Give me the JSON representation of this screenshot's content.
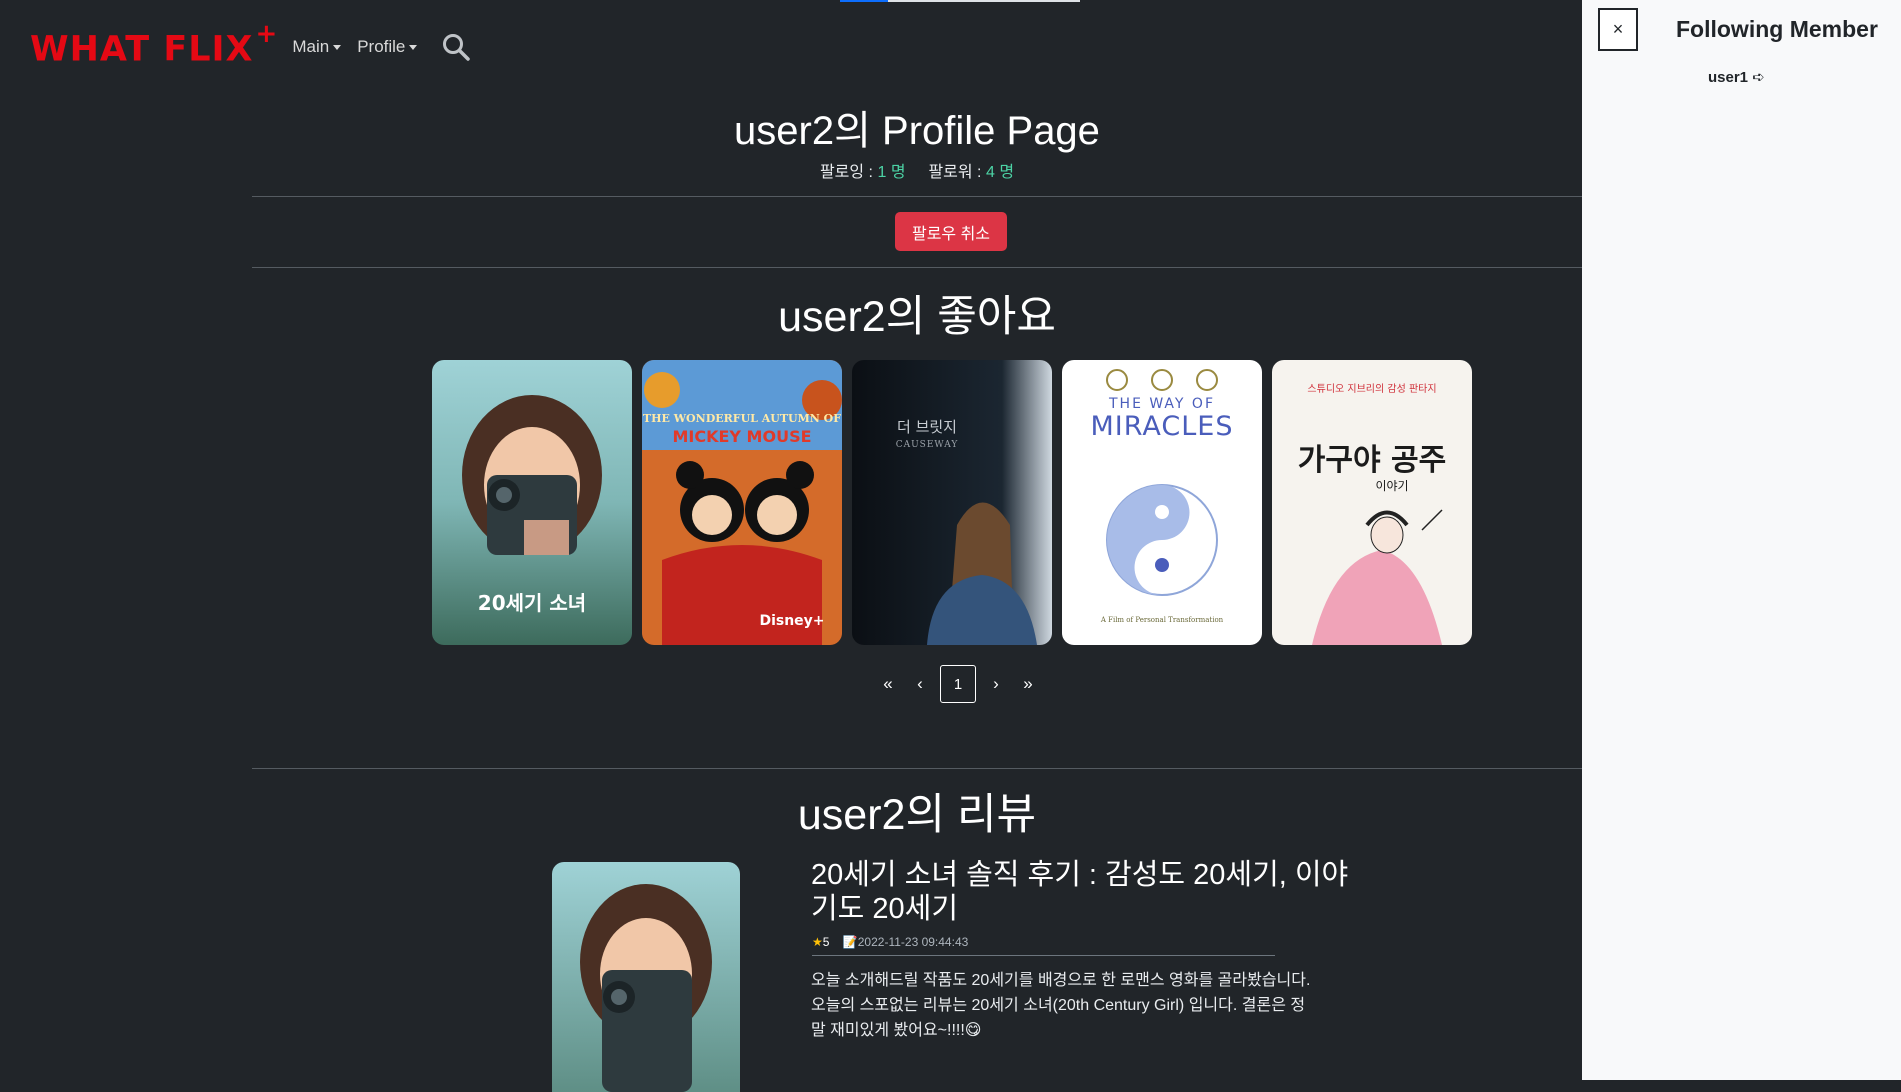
{
  "navbar": {
    "brand": "WHAT FLIX",
    "brand_plus": "+",
    "items": [
      {
        "label": "Main"
      },
      {
        "label": "Profile"
      }
    ]
  },
  "profile": {
    "title": "user2의 Profile Page",
    "following_label": "팔로잉 :",
    "following_count": "1 명",
    "follower_label": "팔로워 :",
    "follower_count": "4 명",
    "unfollow_label": "팔로우 취소"
  },
  "likes": {
    "title": "user2의 좋아요",
    "posters": [
      {
        "text": "20세기 소녀"
      },
      {
        "text": "THE WONDERFUL AUTUMN OF MICKEY MOUSE"
      },
      {
        "text": "더 브릿지 CAUSEWAY"
      },
      {
        "text": "THE WAY OF MIRACLES"
      },
      {
        "text": "가구야 공주 이야기"
      }
    ]
  },
  "pagination": {
    "first": "«",
    "prev": "‹",
    "current": "1",
    "next": "›",
    "last": "»"
  },
  "reviews": {
    "title": "user2의 리뷰",
    "items": [
      {
        "title": "20세기 소녀 솔직 후기 : 감성도 20세기, 이야기도 20세기",
        "rating": "5",
        "date": "2022-11-23 09:44:43",
        "body": "오늘 소개해드릴 작품도 20세기를 배경으로 한 로맨스 영화를 골라봤습니다. 오늘의 스포없는 리뷰는 20세기 소녀(20th Century Girl) 입니다. 결론은 정말 재미있게 봤어요~!!!!😋"
      }
    ]
  },
  "offcanvas": {
    "close": "×",
    "title": "Following Member",
    "members": [
      {
        "name": "user1",
        "arrow": "➪"
      }
    ]
  },
  "colors": {
    "background": "#212529",
    "brand": "#e50914",
    "danger": "#dc3545",
    "count": "#4cd3a5",
    "panel": "#f8f9fa"
  }
}
